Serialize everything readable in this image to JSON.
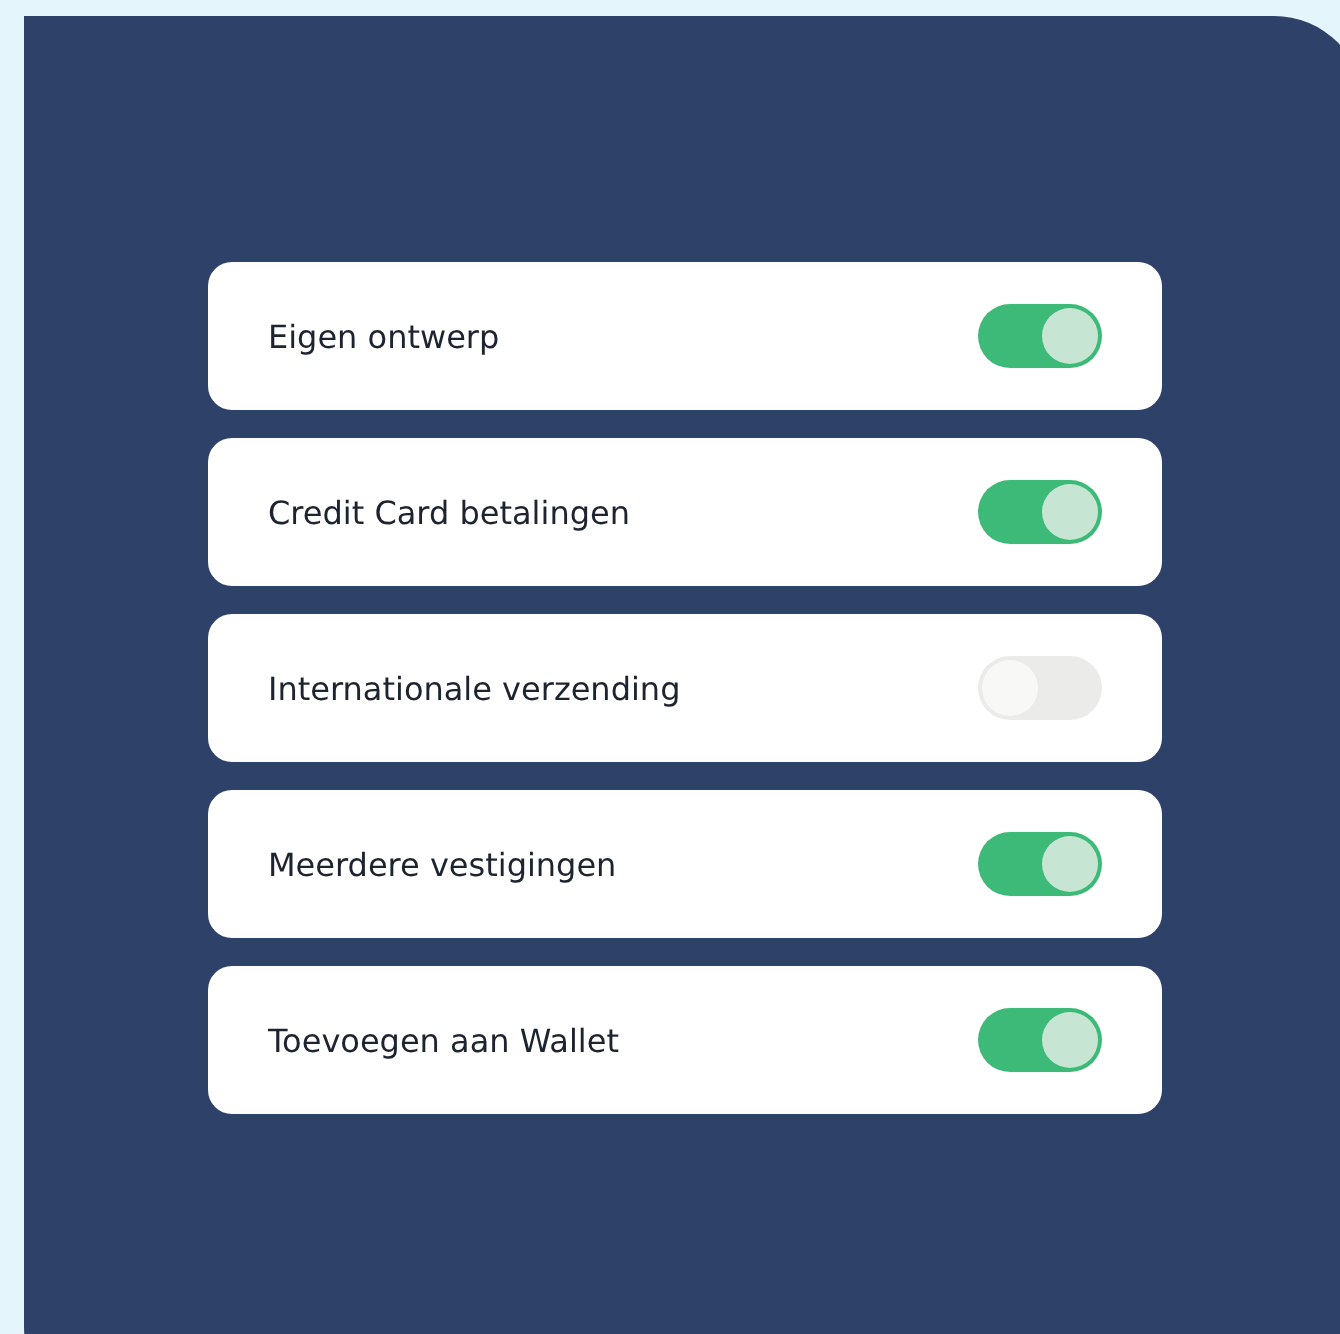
{
  "settings": [
    {
      "label": "Eigen ontwerp",
      "on": true
    },
    {
      "label": "Credit Card betalingen",
      "on": true
    },
    {
      "label": "Internationale verzending",
      "on": false
    },
    {
      "label": "Meerdere vestigingen",
      "on": true
    },
    {
      "label": "Toevoegen aan Wallet",
      "on": true
    }
  ]
}
